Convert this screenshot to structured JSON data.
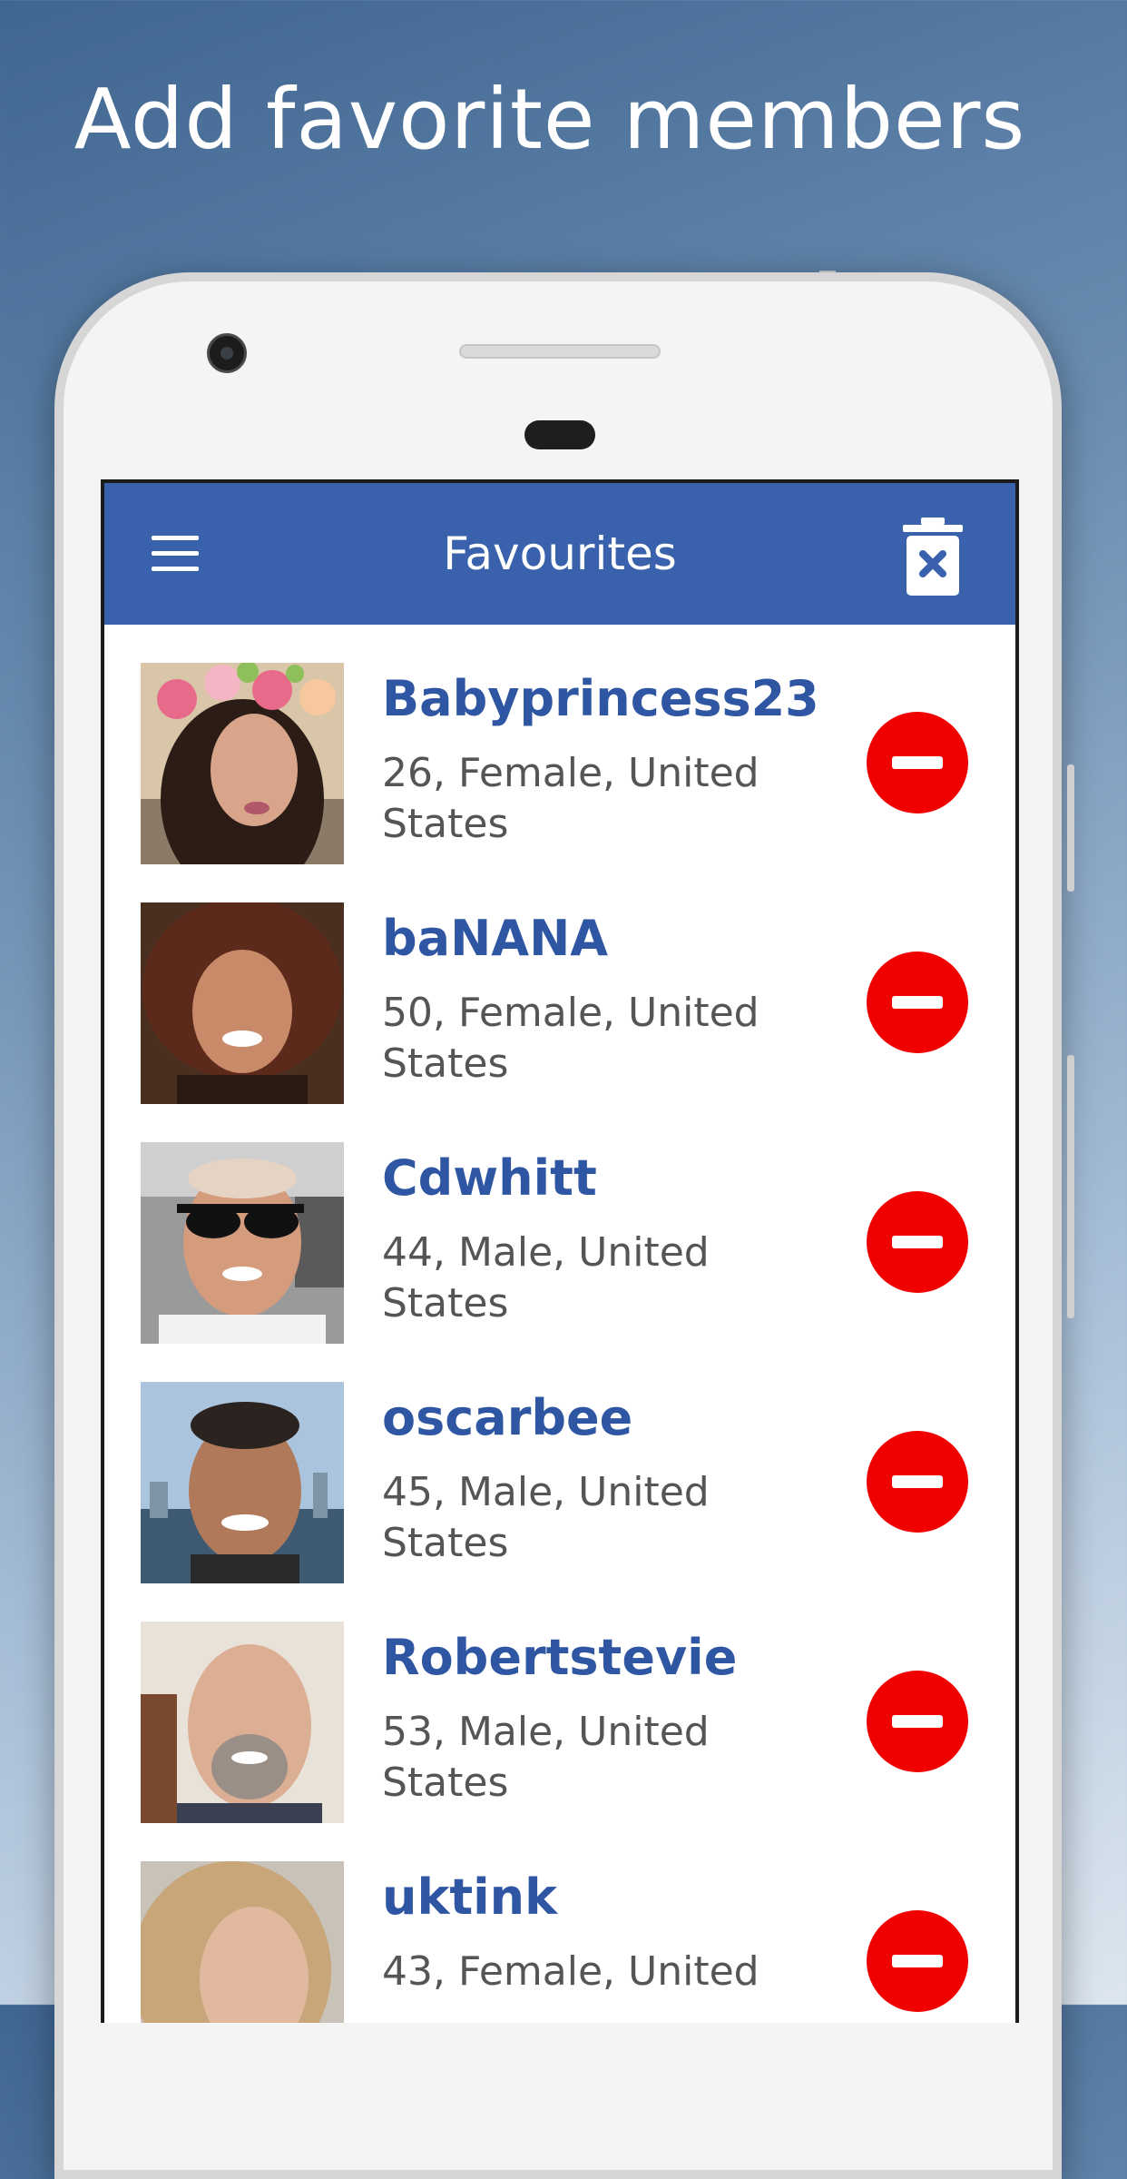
{
  "headline": "Add favorite members",
  "appbar": {
    "title": "Favourites",
    "menu_icon": "hamburger-menu-icon",
    "action_icon": "trash-delete-all-icon"
  },
  "colors": {
    "appbar": "#3a61ac",
    "username": "#2f56a2",
    "remove_button": "#f10000"
  },
  "members": [
    {
      "name": "Babyprincess23",
      "details": "26, Female, United States"
    },
    {
      "name": "baNANA",
      "details": "50, Female, United States"
    },
    {
      "name": "Cdwhitt",
      "details": "44, Male, United States"
    },
    {
      "name": "oscarbee",
      "details": "45, Male, United States"
    },
    {
      "name": "Robertstevie",
      "details": "53, Male, United States"
    },
    {
      "name": "uktink",
      "details": "43, Female, United"
    }
  ]
}
